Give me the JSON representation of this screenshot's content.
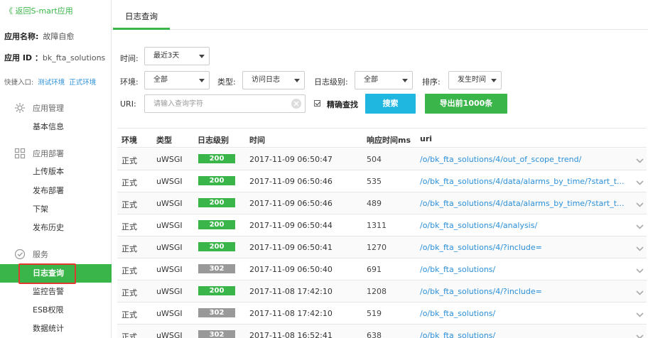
{
  "sidebar": {
    "back_label": "《 返回S-mart应用",
    "app_name_label": "应用名称:",
    "app_name_value": "故障自愈",
    "app_id_label": "应用 ID ：",
    "app_id_value": "bk_fta_solutions",
    "quick_entry_label": "快捷入口:",
    "test_env_label": "测试环境",
    "prod_env_label": "正式环境",
    "sections": [
      {
        "label": "应用管理",
        "icon": "gear-icon"
      },
      {
        "label": "应用部署",
        "icon": "grid-icon"
      },
      {
        "label": "服务",
        "icon": "check-circle-icon"
      }
    ],
    "items": {
      "basic_info": "基本信息",
      "upload_version": "上传版本",
      "deploy": "发布部署",
      "offline": "下架",
      "deploy_history": "发布历史",
      "log_query": "日志查询",
      "monitor_alarm": "监控告警",
      "esb_permission": "ESB权限",
      "data_stats": "数据统计"
    }
  },
  "tabs": {
    "log_query": "日志查询"
  },
  "filters": {
    "time_label": "时间:",
    "time_value": "最近3天",
    "env_label": "环境:",
    "env_value": "全部",
    "type_label": "类型:",
    "type_value": "访问日志",
    "level_label": "日志级别:",
    "level_value": "全部",
    "sort_label": "排序:",
    "sort_value": "发生时间",
    "uri_label": "URI:",
    "uri_placeholder": "请输入查询字符",
    "exact_label": "精确查找",
    "exact_checked": true,
    "search_label": "搜索",
    "export_label": "导出前1000条"
  },
  "colors": {
    "accent": "#3ab54a",
    "search_btn": "#1fb6e0",
    "status_200": "#3ab54a",
    "status_302": "#999999",
    "link": "#2a8fd8",
    "highlight_box": "#e23a2e"
  },
  "table": {
    "headers": {
      "env": "环境",
      "type": "类型",
      "level": "日志级别",
      "time": "时间",
      "resp": "响应时间ms",
      "uri": "uri"
    },
    "rows": [
      {
        "env": "正式",
        "type": "uWSGI",
        "status": "200",
        "time": "2017-11-09 06:50:47",
        "ms": "504",
        "uri": "/o/bk_fta_solutions/4/out_of_scope_trend/"
      },
      {
        "env": "正式",
        "type": "uWSGI",
        "status": "200",
        "time": "2017-11-09 06:50:46",
        "ms": "535",
        "uri": "/o/bk_fta_solutions/4/data/alarms_by_time/?start_t..."
      },
      {
        "env": "正式",
        "type": "uWSGI",
        "status": "200",
        "time": "2017-11-09 06:50:46",
        "ms": "489",
        "uri": "/o/bk_fta_solutions/4/data/alarms_by_time/?start_t..."
      },
      {
        "env": "正式",
        "type": "uWSGI",
        "status": "200",
        "time": "2017-11-09 06:50:44",
        "ms": "1311",
        "uri": "/o/bk_fta_solutions/4/analysis/"
      },
      {
        "env": "正式",
        "type": "uWSGI",
        "status": "200",
        "time": "2017-11-09 06:50:41",
        "ms": "1270",
        "uri": "/o/bk_fta_solutions/4/?include="
      },
      {
        "env": "正式",
        "type": "uWSGI",
        "status": "302",
        "time": "2017-11-09 06:50:40",
        "ms": "691",
        "uri": "/o/bk_fta_solutions/"
      },
      {
        "env": "正式",
        "type": "uWSGI",
        "status": "200",
        "time": "2017-11-08 17:42:10",
        "ms": "1208",
        "uri": "/o/bk_fta_solutions/4/?include="
      },
      {
        "env": "正式",
        "type": "uWSGI",
        "status": "302",
        "time": "2017-11-08 17:42:10",
        "ms": "519",
        "uri": "/o/bk_fta_solutions/"
      },
      {
        "env": "正式",
        "type": "uWSGI",
        "status": "302",
        "time": "2017-11-08 16:52:41",
        "ms": "638",
        "uri": "/o/bk_fta_solutions/"
      }
    ]
  }
}
